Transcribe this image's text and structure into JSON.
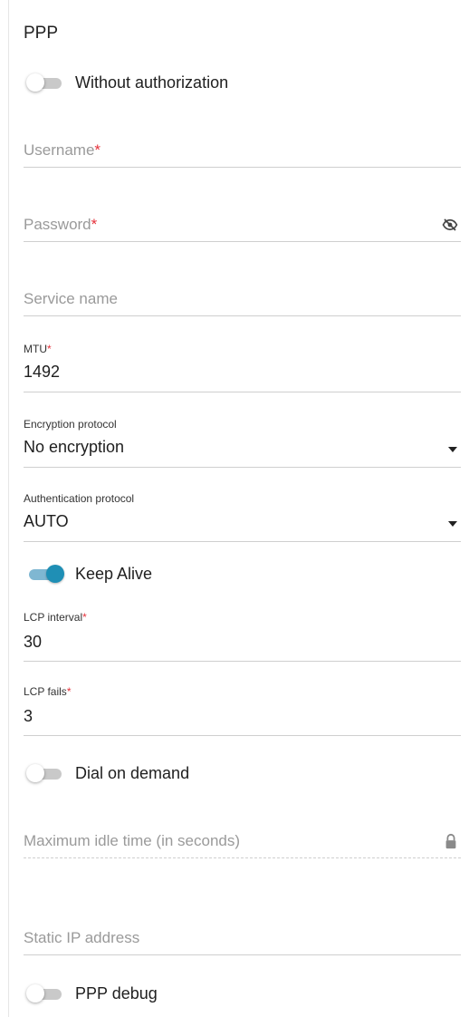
{
  "section": {
    "title": "PPP"
  },
  "without_authorization": {
    "label": "Without authorization",
    "state": "off"
  },
  "username": {
    "label": "Username",
    "required_mark": "*",
    "value": ""
  },
  "password": {
    "label": "Password",
    "required_mark": "*",
    "value": "",
    "icon": "eye-off-icon"
  },
  "service_name": {
    "label": "Service name",
    "value": ""
  },
  "mtu": {
    "label": "MTU",
    "required_mark": "*",
    "value": "1492"
  },
  "encryption_protocol": {
    "label": "Encryption protocol",
    "value": "No encryption",
    "icon": "caret-down-icon"
  },
  "authentication_protocol": {
    "label": "Authentication protocol",
    "value": "AUTO",
    "icon": "caret-down-icon"
  },
  "keep_alive": {
    "label": "Keep Alive",
    "state": "on"
  },
  "lcp_interval": {
    "label": "LCP interval",
    "required_mark": "*",
    "value": "30"
  },
  "lcp_fails": {
    "label": "LCP fails",
    "required_mark": "*",
    "value": "3"
  },
  "dial_on_demand": {
    "label": "Dial on demand",
    "state": "off"
  },
  "max_idle_time": {
    "label": "Maximum idle time (in seconds)",
    "value": "",
    "icon": "lock-icon",
    "disabled": true
  },
  "static_ip": {
    "label": "Static IP address",
    "value": ""
  },
  "ppp_debug": {
    "label": "PPP debug",
    "state": "off"
  },
  "colors": {
    "accent": "#1f8fb5",
    "accent_track": "#7fb7d2",
    "required": "#e5323b",
    "placeholder": "#9a9a9a"
  }
}
